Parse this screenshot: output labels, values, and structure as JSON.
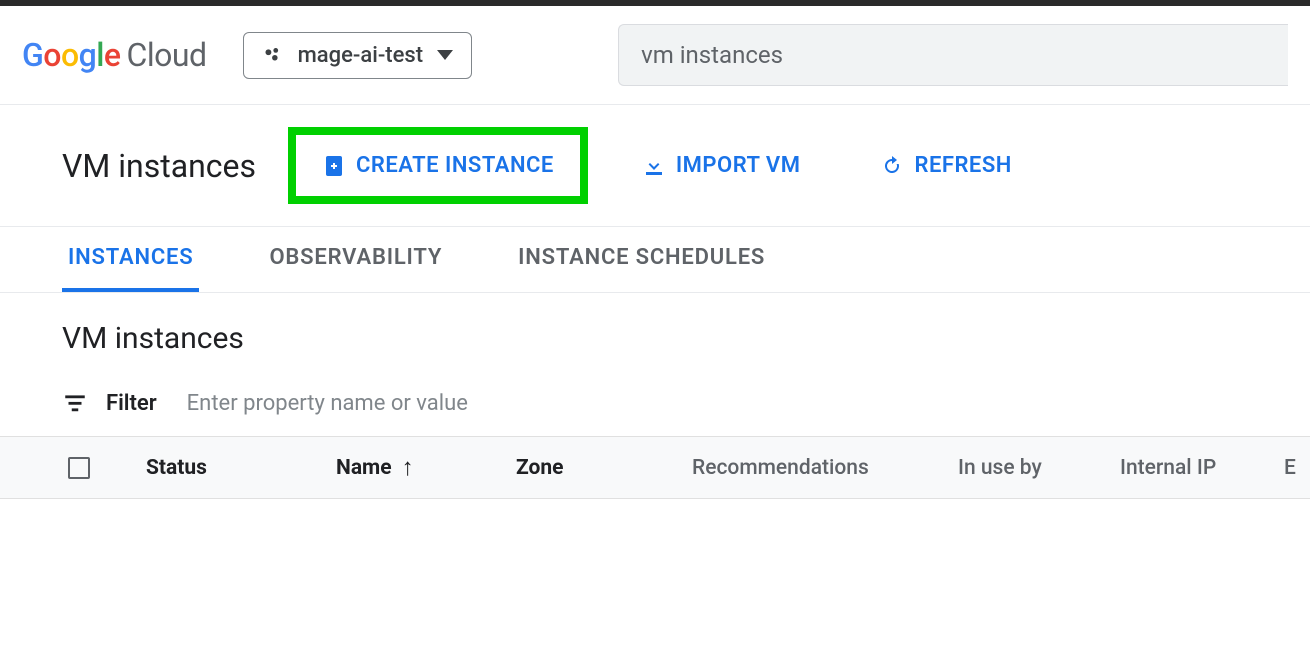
{
  "brand": {
    "g": "G",
    "o1": "o",
    "o2": "o",
    "g2": "g",
    "l": "l",
    "e": "e",
    "cloud": "Cloud"
  },
  "project": {
    "name": "mage-ai-test"
  },
  "search": {
    "value": "vm instances"
  },
  "page": {
    "title": "VM instances",
    "section_title": "VM instances"
  },
  "actions": {
    "create": "CREATE INSTANCE",
    "import": "IMPORT VM",
    "refresh": "REFRESH"
  },
  "tabs": {
    "instances": "INSTANCES",
    "observability": "OBSERVABILITY",
    "schedules": "INSTANCE SCHEDULES"
  },
  "filter": {
    "label": "Filter",
    "placeholder": "Enter property name or value"
  },
  "columns": {
    "status": "Status",
    "name": "Name",
    "zone": "Zone",
    "recommendations": "Recommendations",
    "in_use_by": "In use by",
    "internal_ip": "Internal IP",
    "external_partial": "E"
  }
}
